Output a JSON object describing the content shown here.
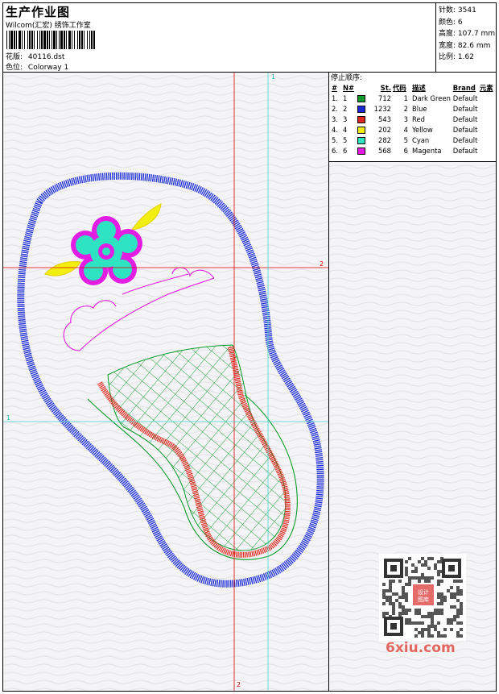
{
  "header": {
    "title": "生产作业图",
    "subtitle": "Wilcom(汇宏) 绣饰工作室",
    "file_label": "花版:",
    "file_name": "40116.dst",
    "colorway_label": "色位:",
    "colorway_name": "Colorway 1"
  },
  "stats": [
    {
      "label": "针数:",
      "value": "3541"
    },
    {
      "label": "颜色:",
      "value": "6"
    },
    {
      "label": "高度:",
      "value": "107.7 mm"
    },
    {
      "label": "宽度:",
      "value": "82.6 mm"
    },
    {
      "label": "比例:",
      "value": "1.62"
    }
  ],
  "stop_sequence": {
    "title": "停止顺序:",
    "columns": [
      "#",
      "N#",
      "St.",
      "代码",
      "描述",
      "Brand",
      "元素"
    ],
    "rows": [
      {
        "num": "1.",
        "n": "1",
        "color": "#0c9a2a",
        "st": "712",
        "code": "1",
        "desc": "Dark Green",
        "brand": "Default"
      },
      {
        "num": "2.",
        "n": "2",
        "color": "#1a2bd6",
        "st": "1232",
        "code": "2",
        "desc": "Blue",
        "brand": "Default"
      },
      {
        "num": "3.",
        "n": "3",
        "color": "#e0281e",
        "st": "543",
        "code": "3",
        "desc": "Red",
        "brand": "Default"
      },
      {
        "num": "4.",
        "n": "4",
        "color": "#f2ee10",
        "st": "202",
        "code": "4",
        "desc": "Yellow",
        "brand": "Default"
      },
      {
        "num": "5.",
        "n": "5",
        "color": "#2ee3c2",
        "st": "282",
        "code": "5",
        "desc": "Cyan",
        "brand": "Default"
      },
      {
        "num": "6.",
        "n": "6",
        "color": "#e21ee2",
        "st": "568",
        "code": "6",
        "desc": "Magenta",
        "brand": "Default"
      }
    ]
  },
  "guides": {
    "red_h_label": "2",
    "red_v_label": "2",
    "cyan_h_label": "1",
    "cyan_v_label": "1"
  },
  "watermark": {
    "site": "6xiu.com",
    "stamp": "设计图库"
  },
  "colors": {
    "dark_green": "#0c9a2a",
    "blue": "#1a2bd6",
    "red": "#e0281e",
    "yellow": "#f2ee10",
    "cyan": "#2ee3c2",
    "magenta": "#e21ee2",
    "guide_red": "#e00000",
    "guide_cyan": "#40d8c8"
  }
}
